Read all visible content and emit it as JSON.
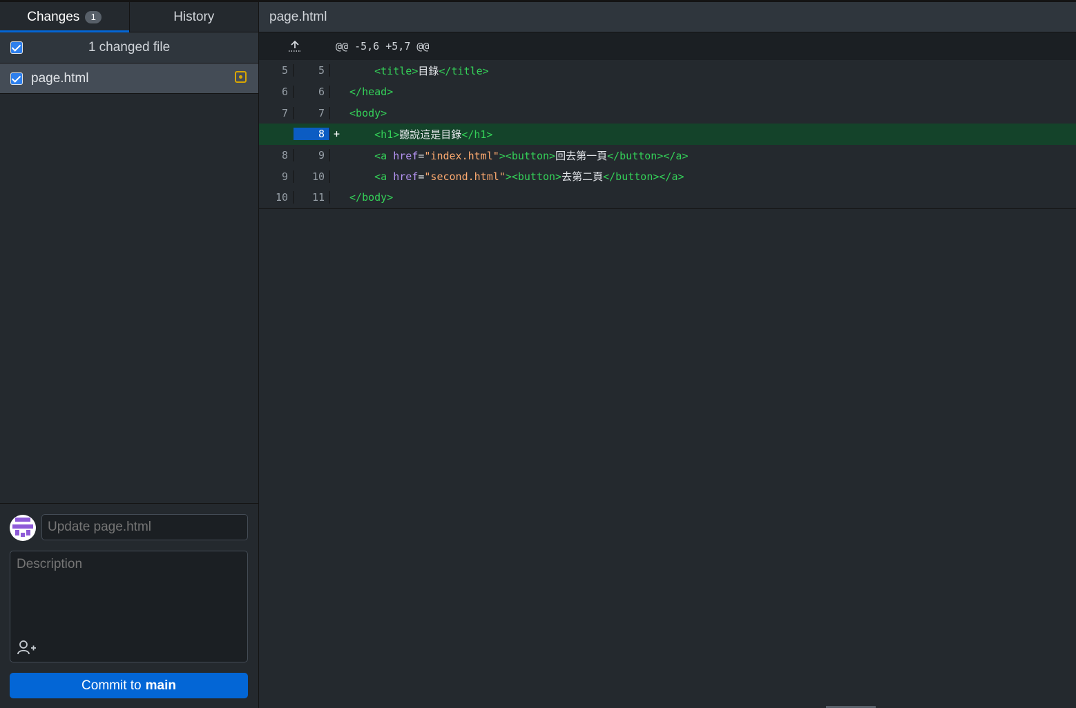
{
  "tabs": [
    {
      "label": "Changes",
      "count": "1",
      "active": true
    },
    {
      "label": "History",
      "active": false
    }
  ],
  "changes": {
    "header_label": "1 changed file",
    "files": [
      {
        "name": "page.html",
        "status": "modified",
        "checked": true
      }
    ]
  },
  "commit": {
    "summary_placeholder": "Update page.html",
    "description_placeholder": "Description",
    "button_prefix": "Commit to",
    "branch": "main"
  },
  "diff": {
    "file_title": "page.html",
    "hunk_header": "@@ -5,6 +5,7 @@",
    "lines": [
      {
        "old": "5",
        "new": "5",
        "type": "context",
        "marker": "",
        "indent": "    ",
        "tokens": [
          [
            "tag",
            "<title>"
          ],
          [
            "txt",
            "目錄"
          ],
          [
            "tag",
            "</title>"
          ]
        ]
      },
      {
        "old": "6",
        "new": "6",
        "type": "context",
        "marker": "",
        "indent": "",
        "tokens": [
          [
            "tag",
            "</head>"
          ]
        ]
      },
      {
        "old": "7",
        "new": "7",
        "type": "context",
        "marker": "",
        "indent": "",
        "tokens": [
          [
            "tag",
            "<body>"
          ]
        ]
      },
      {
        "old": "",
        "new": "8",
        "type": "added",
        "marker": "+",
        "indent": "    ",
        "tokens": [
          [
            "tag",
            "<h1>"
          ],
          [
            "txt",
            "聽說這是目錄"
          ],
          [
            "tag",
            "</h1>"
          ]
        ]
      },
      {
        "old": "8",
        "new": "9",
        "type": "context",
        "marker": "",
        "indent": "    ",
        "tokens": [
          [
            "tag",
            "<a "
          ],
          [
            "attr",
            "href"
          ],
          [
            "txt",
            "="
          ],
          [
            "str",
            "\"index.html\""
          ],
          [
            "tag",
            "><button>"
          ],
          [
            "txt",
            "回去第一頁"
          ],
          [
            "tag",
            "</button></a>"
          ]
        ]
      },
      {
        "old": "9",
        "new": "10",
        "type": "context",
        "marker": "",
        "indent": "    ",
        "tokens": [
          [
            "tag",
            "<a "
          ],
          [
            "attr",
            "href"
          ],
          [
            "txt",
            "="
          ],
          [
            "str",
            "\"second.html\""
          ],
          [
            "tag",
            "><button>"
          ],
          [
            "txt",
            "去第二頁"
          ],
          [
            "tag",
            "</button></a>"
          ]
        ]
      },
      {
        "old": "10",
        "new": "11",
        "type": "context",
        "marker": "",
        "indent": "",
        "tokens": [
          [
            "tag",
            "</body>"
          ]
        ]
      }
    ]
  },
  "colors": {
    "accent": "#0366d6",
    "added_bg": "#14432a",
    "modified_icon": "#d9a600"
  }
}
